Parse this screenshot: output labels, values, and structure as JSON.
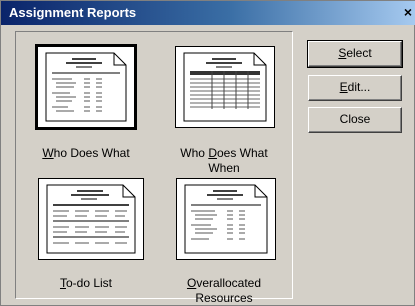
{
  "dialog": {
    "title": "Assignment Reports",
    "close_glyph": "×"
  },
  "reports": [
    {
      "label_line1": "Who Does What",
      "label_line2": "",
      "hotkey_char": "W",
      "selected": true
    },
    {
      "label_line1": "Who Does What",
      "label_line2": "When",
      "hotkey_char": "D",
      "selected": false
    },
    {
      "label_line1": "To-do List",
      "label_line2": "",
      "hotkey_char": "T",
      "selected": false
    },
    {
      "label_line1": "Overallocated",
      "label_line2": "Resources",
      "hotkey_char": "O",
      "selected": false
    }
  ],
  "buttons": {
    "select": "Select",
    "edit": "Edit...",
    "close": "Close"
  }
}
